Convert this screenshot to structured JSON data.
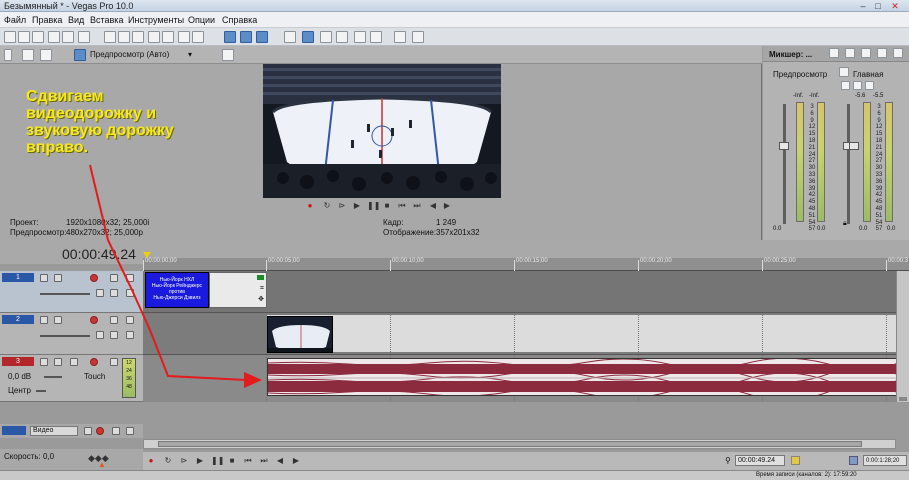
{
  "window": {
    "title": "Безымянный * - Vegas Pro 10.0",
    "controls": [
      "–",
      "□",
      "✕"
    ]
  },
  "menu": [
    "Файл",
    "Правка",
    "Вид",
    "Вставка",
    "Инструменты",
    "Опции",
    "Справка"
  ],
  "preview": {
    "mode_label": "Предпросмотр (Авто)",
    "project_label": "Проект:",
    "project_value": "1920x1080x32; 25,000i",
    "preview_label": "Предпросмотр:",
    "preview_value": "480x270x32; 25,000p",
    "frame_label": "Кадр:",
    "frame_value": "1 249",
    "display_label": "Отображение:",
    "display_value": "357x201x32"
  },
  "mixer": {
    "title": "Микшер: ...",
    "preview_label": "Предпросмотр",
    "master_label": "Главная",
    "left_peaks": [
      "-Inf.",
      "-Inf."
    ],
    "right_peaks": [
      "-5.6",
      "-5.5"
    ],
    "scale": [
      "3",
      "6",
      "9",
      "12",
      "15",
      "18",
      "21",
      "24",
      "27",
      "30",
      "33",
      "36",
      "39",
      "42",
      "45",
      "48",
      "51",
      "54",
      "57"
    ],
    "fader_values": [
      "0.0",
      "0.0",
      "0.0",
      "0.0"
    ]
  },
  "timeline": {
    "timecode": "00:00:49.24",
    "ruler": [
      "00:00:00;00",
      "00:00:05;00",
      "00:00:10;00",
      "00:00:15;00",
      "00:00:20;00",
      "00:00:25;00",
      "00:00:3"
    ],
    "tracks": [
      {
        "number": "1",
        "kind": "video"
      },
      {
        "number": "2",
        "kind": "video"
      },
      {
        "number": "3",
        "kind": "audio",
        "volume": "0,0 dB",
        "mode": "Touch",
        "pan": "Центр",
        "meter": [
          "12",
          "24",
          "36",
          "48"
        ]
      }
    ],
    "title_clip_text": [
      "Нью-Йорк НХЛ",
      "Нью-Йорк Рейнджерс",
      "против",
      "Нью-Джерси Дэвилз"
    ],
    "bus_label": "Видео",
    "speed_label": "Скорость: 0,0"
  },
  "annotation": {
    "lines": [
      "Сдвигаем",
      "видеодорожку и",
      "звуковую дорожку",
      "вправо."
    ]
  },
  "bottom": {
    "timecode": "00:00:49.24",
    "status": "Время записи (каналов: 2): 17:59:20",
    "end_time": "0:00:1:28;20"
  },
  "colors": {
    "annotation": "#f7e71c",
    "arrow": "#e31b1b",
    "clip_title": "#1a1adf",
    "audio_wave": "#8c2a3e"
  }
}
